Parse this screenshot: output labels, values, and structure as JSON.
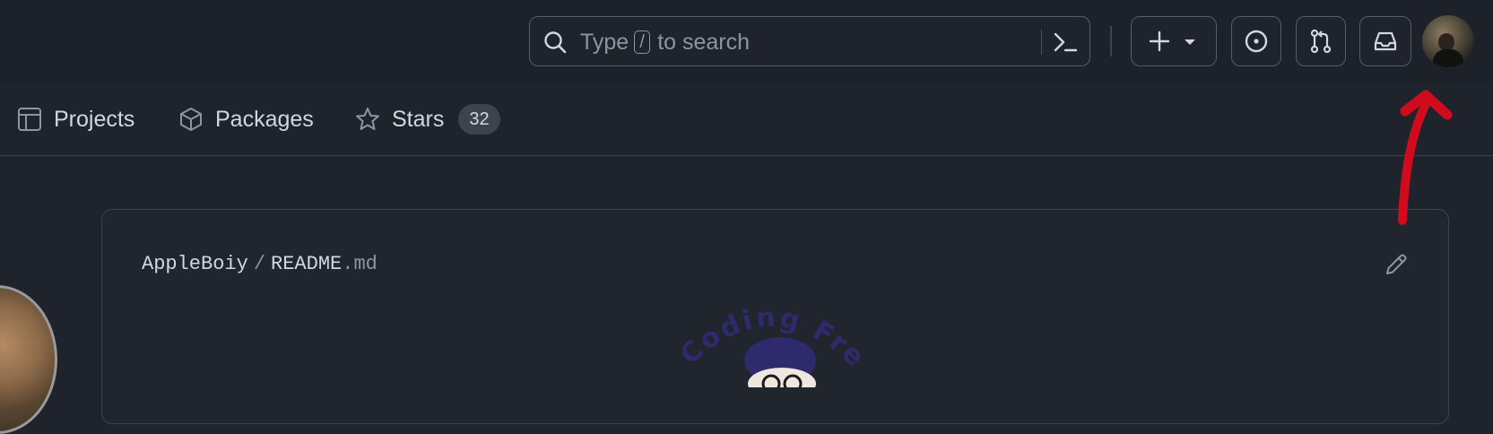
{
  "header": {
    "search": {
      "placeholder_pre": "Type",
      "key": "/",
      "placeholder_post": "to search"
    },
    "buttons": [
      "create-new",
      "issues",
      "pull-requests",
      "inbox"
    ]
  },
  "tabs": [
    {
      "label": "Projects",
      "icon": "table-icon"
    },
    {
      "label": "Packages",
      "icon": "package-icon"
    },
    {
      "label": "Stars",
      "icon": "star-icon",
      "count": "32"
    }
  ],
  "readme": {
    "owner": "AppleBoiy",
    "separator": "/",
    "file_name": "README",
    "file_ext": ".md",
    "logo_text": "Coding Free"
  },
  "colors": {
    "background": "#1f232c",
    "border": "#3d444e",
    "annotation": "#d10b1e"
  }
}
